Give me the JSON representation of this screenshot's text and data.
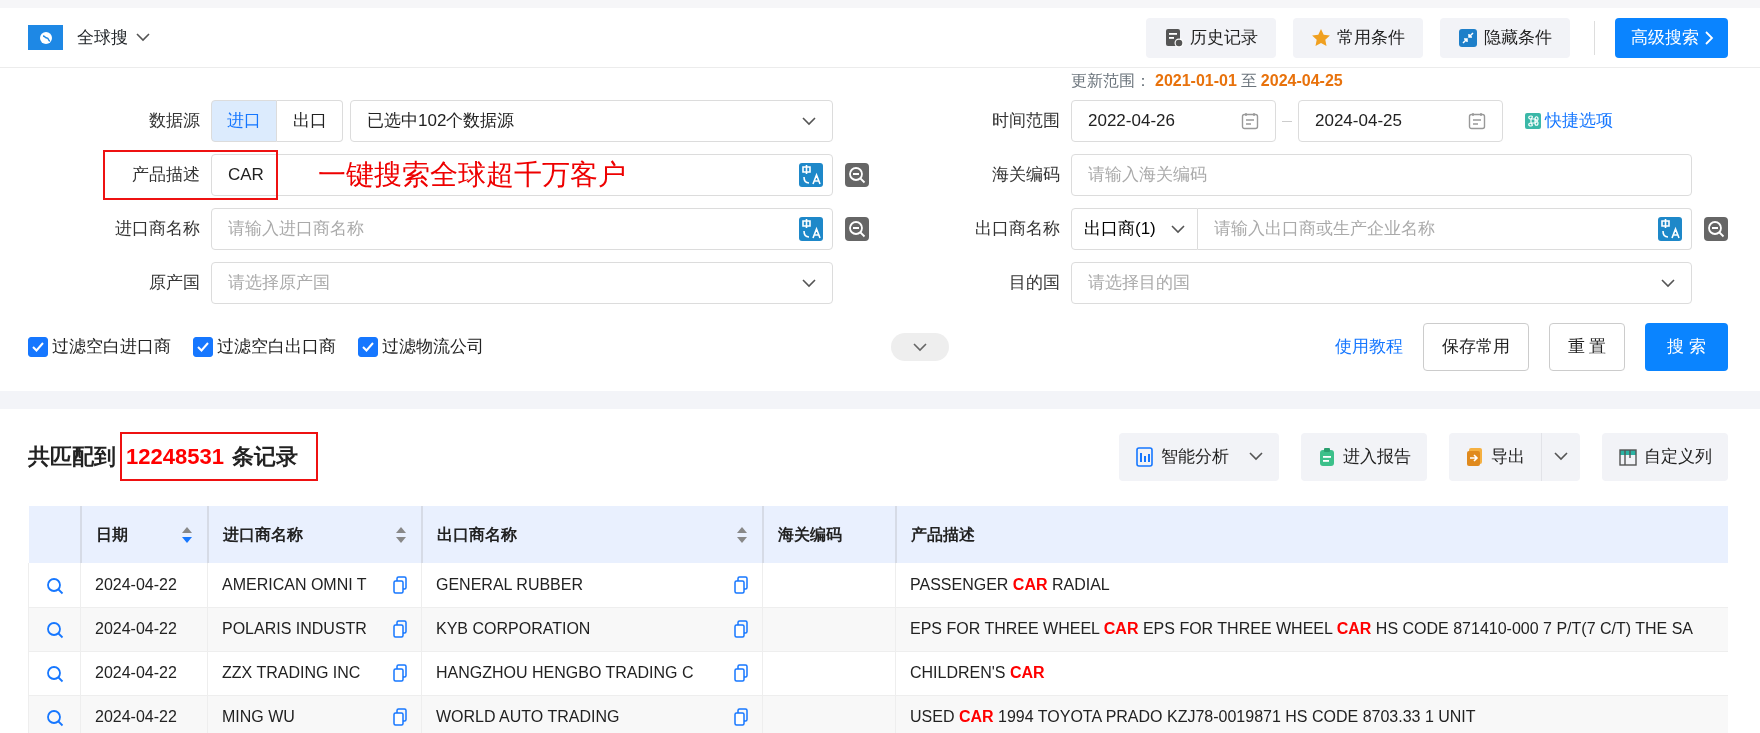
{
  "header": {
    "title": "全球搜",
    "buttons": [
      {
        "label": "历史记录",
        "kind": "history"
      },
      {
        "label": "常用条件",
        "kind": "favorites"
      },
      {
        "label": "隐藏条件",
        "kind": "hide"
      }
    ],
    "primary_button": "高级搜索"
  },
  "update_range": {
    "label": "更新范围：",
    "start": "2021-01-01",
    "separator": "至",
    "end": "2024-04-25"
  },
  "form_left": [
    {
      "kind": "toggle-select",
      "label": "数据源",
      "options": [
        {
          "label": "进口",
          "selected": true
        },
        {
          "label": "出口",
          "selected": false
        }
      ],
      "value": "已选中102个数据源"
    },
    {
      "kind": "text",
      "label": "产品描述",
      "value": "CAR",
      "highlighted": true,
      "annotation": "一键搜索全球超千万客户",
      "translate": true,
      "search_icon": true
    },
    {
      "kind": "text",
      "label": "进口商名称",
      "placeholder": "请输入进口商名称",
      "translate": true,
      "search_icon": true
    },
    {
      "kind": "select",
      "label": "原产国",
      "placeholder": "请选择原产国"
    }
  ],
  "form_right": [
    {
      "kind": "date-range",
      "label": "时间范围",
      "start": "2022-04-26",
      "end": "2024-04-25",
      "link": "快捷选项"
    },
    {
      "kind": "text",
      "label": "海关编码",
      "placeholder": "请输入海关编码"
    },
    {
      "kind": "prefixed",
      "label": "出口商名称",
      "prefix": "出口商(1)",
      "placeholder": "请输入出口商或生产企业名称",
      "translate": true,
      "search_icon": true
    },
    {
      "kind": "select",
      "label": "目的国",
      "placeholder": "请选择目的国"
    }
  ],
  "expand_toggle": {
    "expanded": false
  },
  "filters": [
    {
      "label": "过滤空白进口商",
      "checked": true
    },
    {
      "label": "过滤空白出口商",
      "checked": true
    },
    {
      "label": "过滤物流公司",
      "checked": true
    }
  ],
  "actions": {
    "tutorial": "使用教程",
    "buttons": [
      {
        "label": "保存常用",
        "kind": "outline"
      },
      {
        "label": "重 置",
        "kind": "outline"
      },
      {
        "label": "搜 索",
        "kind": "primary"
      }
    ]
  },
  "results": {
    "prefix": "共匹配到",
    "count": "12248531",
    "suffix": "条记录",
    "highlighted": true
  },
  "toolbar": [
    {
      "label": "智能分析",
      "kind": "analysis",
      "dropdown": true
    },
    {
      "label": "进入报告",
      "kind": "report"
    },
    {
      "label": "导出",
      "kind": "export",
      "split": true
    },
    {
      "label": "自定义列",
      "kind": "columns"
    }
  ],
  "table": {
    "columns": [
      {},
      {
        "label": "日期",
        "sortable": true,
        "sorted_descending": true
      },
      {
        "label": "进口商名称",
        "sortable": true,
        "sorted_descending": false
      },
      {
        "label": "出口商名称",
        "sortable": true,
        "sorted_descending": false
      },
      {
        "label": "海关编码"
      },
      {
        "label": "产品描述"
      }
    ],
    "rows": [
      {
        "date": "2024-04-22",
        "importer": "AMERICAN OMNI T",
        "exporter": "GENERAL RUBBER",
        "description": "PASSENGER **CAR** RADIAL"
      },
      {
        "date": "2024-04-22",
        "importer": "POLARIS INDUSTR",
        "exporter": "KYB CORPORATION",
        "description": "EPS FOR THREE WHEEL **CAR** EPS FOR THREE WHEEL **CAR** HS CODE 871410-000 7 P/T(7 C/T) THE SA"
      },
      {
        "date": "2024-04-22",
        "importer": "ZZX TRADING INC",
        "exporter": "HANGZHOU HENGBO TRADING C",
        "description": "CHILDREN'S **CAR**"
      },
      {
        "date": "2024-04-22",
        "importer": "MING WU",
        "exporter": "WORLD AUTO TRADING",
        "description": "USED **CAR** 1994 TOYOTA PRADO KZJ78-0019871 HS CODE 8703.33 1 UNIT"
      }
    ]
  }
}
